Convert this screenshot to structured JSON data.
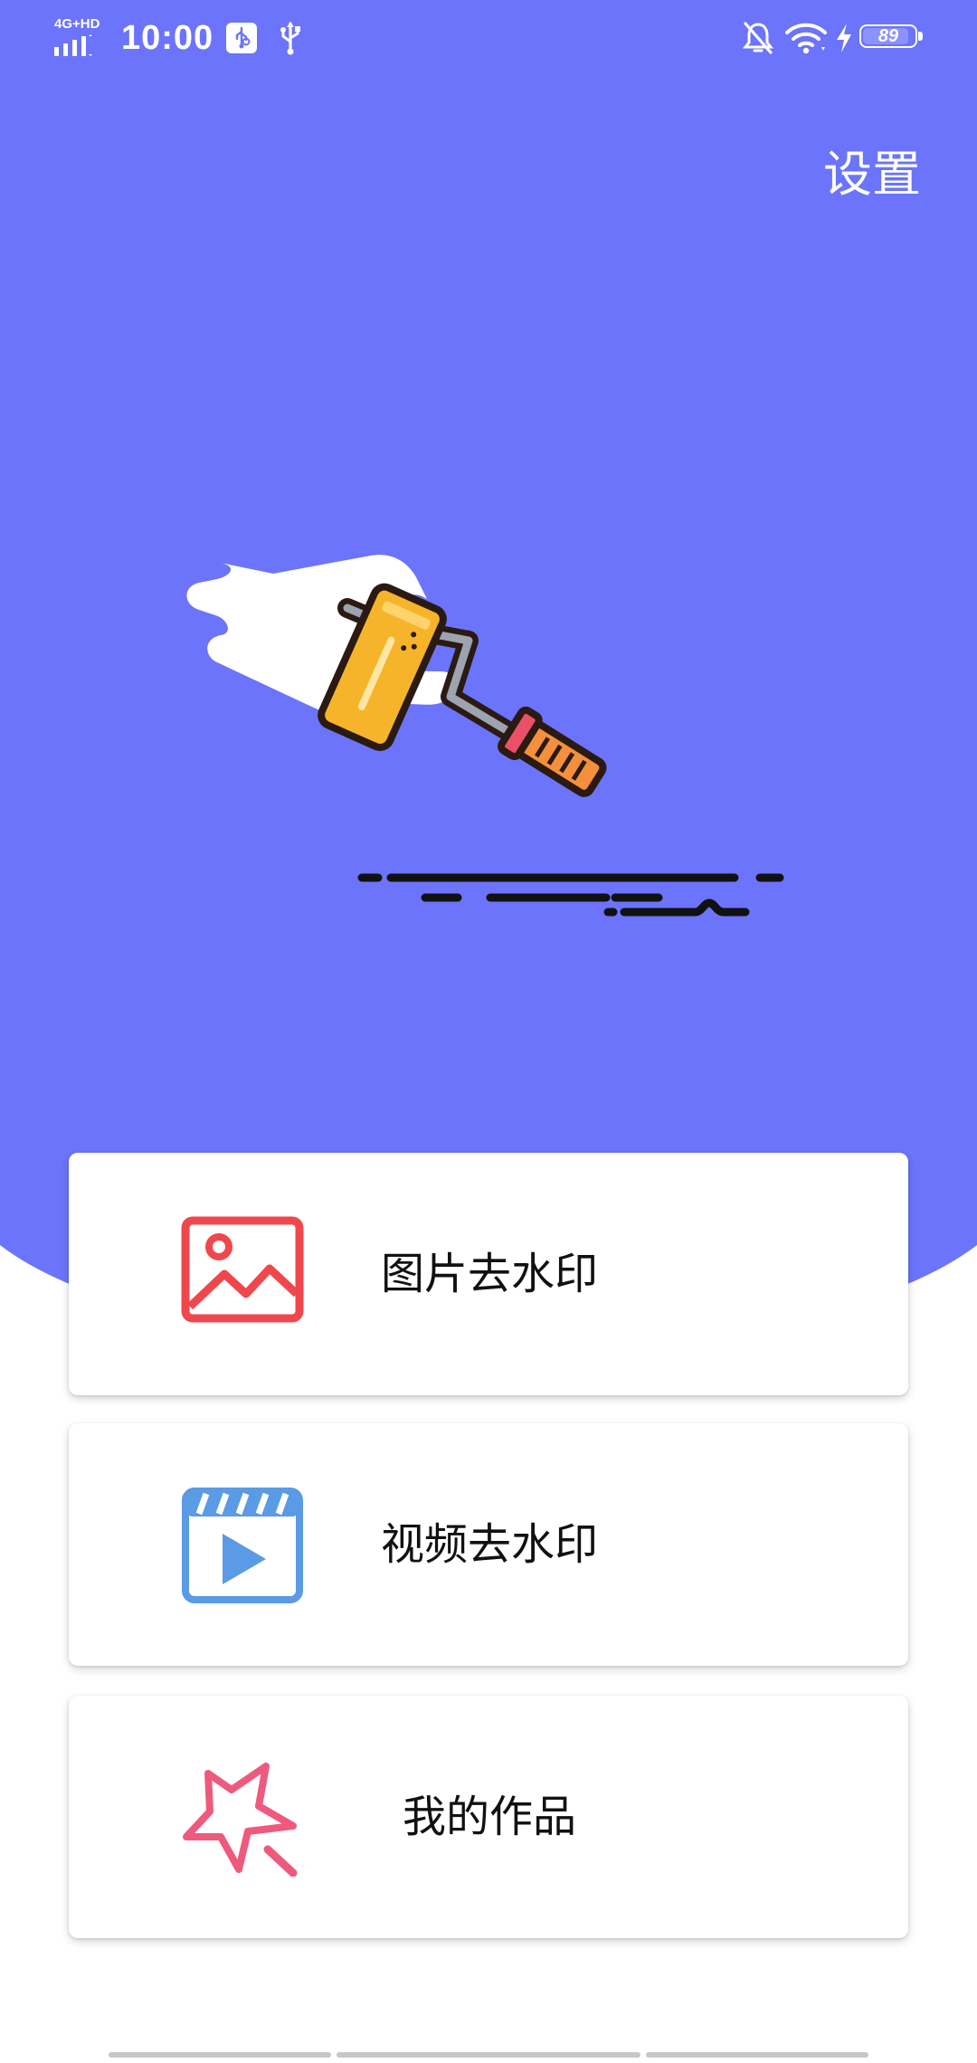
{
  "status_bar": {
    "network": "4G+HD",
    "time": "10:00",
    "battery": 89
  },
  "header": {
    "settings_label": "设置"
  },
  "menu": {
    "items": [
      {
        "label": "图片去水印",
        "icon": "image-icon",
        "color": "#F0474C"
      },
      {
        "label": "视频去水印",
        "icon": "video-icon",
        "color": "#5B9AE4"
      },
      {
        "label": "我的作品",
        "icon": "star-wand-icon",
        "color": "#EE5A7E"
      }
    ]
  },
  "colors": {
    "hero_background": "#6B74FB",
    "card_background": "#FFFFFF"
  }
}
